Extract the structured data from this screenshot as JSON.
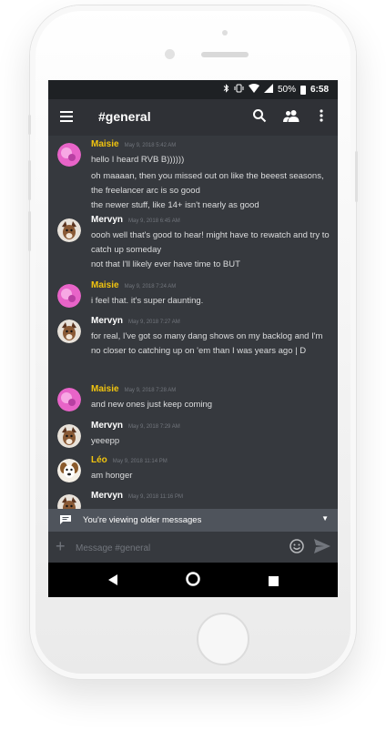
{
  "status_bar": {
    "battery": "50%",
    "time": "6:58",
    "icons": [
      "bluetooth-icon",
      "vibrate-icon",
      "wifi-icon",
      "signal-icon",
      "battery-icon"
    ]
  },
  "header": {
    "channel": "#general",
    "icons": [
      "menu-icon",
      "search-icon",
      "members-icon",
      "more-vert-icon"
    ]
  },
  "messages": [
    {
      "author": "Maisie",
      "author_color": "#f1c40f",
      "avatar": "pink-avatar",
      "timestamp": "May 9, 2018 5:42 AM",
      "lines": [
        "hello I heard RVB B))))))",
        "oh maaaan, then you missed out on like the beeest seasons, the freelancer arc is so good",
        "the newer stuff, like 14+ isn't nearly as good"
      ]
    },
    {
      "author": "Mervyn",
      "author_color": "#ffffff",
      "avatar": "dog-avatar",
      "timestamp": "May 9, 2018 6:45 AM",
      "lines": [
        "oooh well that's good to hear! might have to rewatch and try to catch up someday",
        "not that I'll likely ever have time to BUT"
      ]
    },
    {
      "author": "Maisie",
      "author_color": "#f1c40f",
      "avatar": "pink-avatar",
      "timestamp": "May 9, 2018 7:24 AM",
      "lines": [
        "i feel that. it's super daunting."
      ]
    },
    {
      "author": "Mervyn",
      "author_color": "#ffffff",
      "avatar": "dog-avatar",
      "timestamp": "May 9, 2018 7:27 AM",
      "lines": [
        "for real, I've got so many dang shows on my backlog and I'm no closer to catching up on 'em than I was years ago | D"
      ]
    },
    {
      "author": "Maisie",
      "author_color": "#f1c40f",
      "avatar": "pink-avatar",
      "timestamp": "May 9, 2018 7:28 AM",
      "lines": [
        "and new ones just keep coming"
      ]
    },
    {
      "author": "Mervyn",
      "author_color": "#ffffff",
      "avatar": "dog-avatar",
      "timestamp": "May 9, 2018 7:29 AM",
      "lines": [
        "yeeepp"
      ]
    },
    {
      "author": "Léo",
      "author_color": "#f1c40f",
      "avatar": "puppy-avatar",
      "timestamp": "May 9, 2018 11:14 PM",
      "lines": [
        "am honger"
      ]
    },
    {
      "author": "Mervyn",
      "author_color": "#ffffff",
      "avatar": "dog-avatar",
      "timestamp": "May 9, 2018 11:16 PM",
      "lines": []
    }
  ],
  "older_messages_bar": {
    "text": "You're viewing older messages"
  },
  "composer": {
    "placeholder": "Message #general"
  },
  "nav": {
    "icons": [
      "back-icon",
      "home-icon",
      "recents-icon"
    ]
  },
  "colors": {
    "background": "#36393e",
    "header": "#2f3136",
    "accent_name": "#f1c40f",
    "status_bar": "#1e2124"
  }
}
